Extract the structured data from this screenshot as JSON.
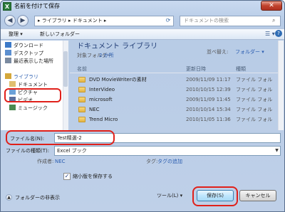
{
  "window": {
    "title": "名前を付けて保存",
    "app_icon_letter": "X",
    "close_glyph": "✕"
  },
  "address": {
    "path": "▸ ライブラリ ▸ ドキュメント ▸",
    "search_placeholder": "ドキュメントの検索"
  },
  "toolbar": {
    "organize": "整理 ▾",
    "new_folder": "新しいフォルダー",
    "view_glyph": "☰ ▾",
    "help_glyph": "?"
  },
  "nav": {
    "items": [
      {
        "label": "ダウンロード",
        "icon": "download-icon",
        "color": "#3c7ac8"
      },
      {
        "label": "デスクトップ",
        "icon": "desktop-icon",
        "color": "#5b8fd0"
      },
      {
        "label": "最近表示した場所",
        "icon": "recent-places-icon",
        "color": "#7a8aa0"
      },
      {
        "label": "",
        "icon": "",
        "color": ""
      },
      {
        "label": "ライブラリ",
        "icon": "library-icon",
        "color": "#d4a73a"
      },
      {
        "label": "ドキュメント",
        "icon": "documents-icon",
        "color": "#e0c070"
      },
      {
        "label": "ピクチャ",
        "icon": "pictures-icon",
        "color": "#6aa0d8"
      },
      {
        "label": "ビデオ",
        "icon": "videos-icon",
        "color": "#5a6f9e"
      },
      {
        "label": "ミュージック",
        "icon": "music-icon",
        "color": "#4a8a50"
      }
    ]
  },
  "main": {
    "library_title": "ドキュメント ライブラリ",
    "target_label": "対象フォルダー:",
    "target_link": "2 か所",
    "sort_label": "並べ替え:",
    "sort_value": "フォルダー ▾",
    "columns": [
      "名前",
      "更新日時",
      "種類"
    ],
    "rows": [
      {
        "name": "DVD MovieWriterの素材",
        "date": "2009/11/09 11:17",
        "type": "ファイル フォル"
      },
      {
        "name": "InterVideo",
        "date": "2010/10/15 12:39",
        "type": "ファイル フォル"
      },
      {
        "name": "microsoft",
        "date": "2009/11/09 11:45",
        "type": "ファイル フォル"
      },
      {
        "name": "NEC",
        "date": "2010/10/14 15:34",
        "type": "ファイル フォル"
      },
      {
        "name": "Trend Micro",
        "date": "2010/11/05 11:36",
        "type": "ファイル フォル"
      }
    ]
  },
  "form": {
    "filename_label": "ファイル名(N):",
    "filename_value": "Test精選-2",
    "filetype_label": "ファイルの種類(T):",
    "filetype_value": "Excel ブック",
    "author_label": "作成者:",
    "author_value": "NEC",
    "tag_label": "タグ:",
    "tag_value": "タグの追加",
    "thumbnail_label": "縮小版を保存する",
    "thumbnail_checked": true
  },
  "footer": {
    "hide_folders": "フォルダーの非表示",
    "tools": "ツール(L) ▾",
    "save": "保存(S)",
    "cancel": "キャンセル"
  },
  "colors": {
    "highlight": "#e0201a",
    "link": "#2a5db0"
  }
}
